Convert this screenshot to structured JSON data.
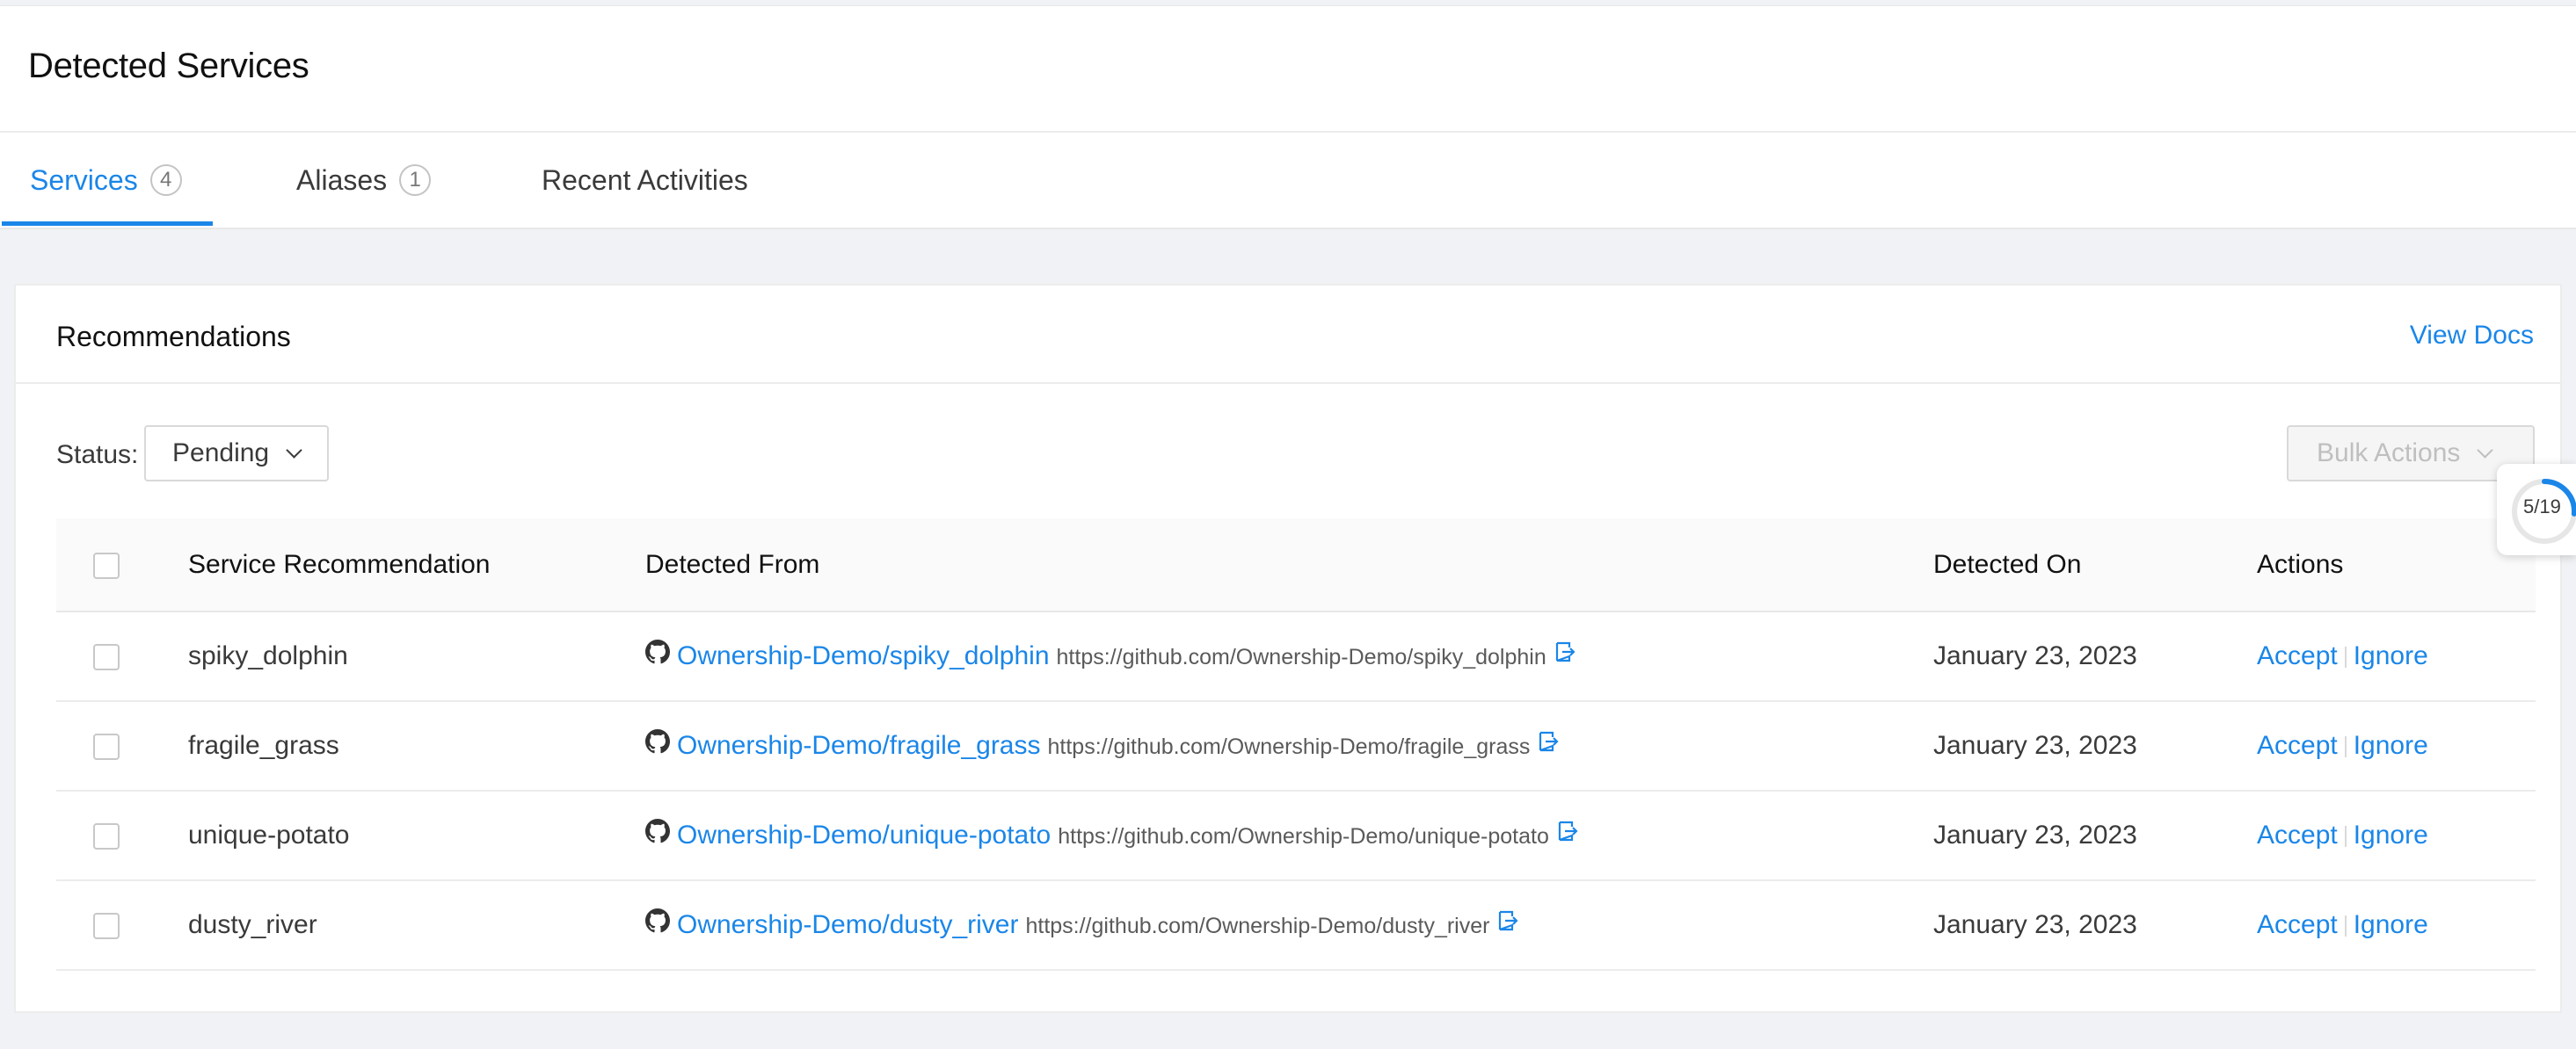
{
  "page": {
    "title": "Detected Services"
  },
  "tabs": [
    {
      "label": "Services",
      "count": "4",
      "active": true
    },
    {
      "label": "Aliases",
      "count": "1",
      "active": false
    },
    {
      "label": "Recent Activities",
      "active": false
    }
  ],
  "card": {
    "title": "Recommendations",
    "view_docs": "View Docs"
  },
  "filters": {
    "status_label": "Status:",
    "status_value": "Pending",
    "bulk_actions": "Bulk Actions"
  },
  "table": {
    "headers": {
      "service": "Service Recommendation",
      "detected_from": "Detected From",
      "detected_on": "Detected On",
      "actions": "Actions"
    },
    "rows": [
      {
        "service": "spiky_dolphin",
        "repo": "Ownership-Demo/spiky_dolphin",
        "url": "https://github.com/Ownership-Demo/spiky_dolphin",
        "detected_on": "January 23, 2023",
        "accept": "Accept",
        "ignore": "Ignore"
      },
      {
        "service": "fragile_grass",
        "repo": "Ownership-Demo/fragile_grass",
        "url": "https://github.com/Ownership-Demo/fragile_grass",
        "detected_on": "January 23, 2023",
        "accept": "Accept",
        "ignore": "Ignore"
      },
      {
        "service": "unique-potato",
        "repo": "Ownership-Demo/unique-potato",
        "url": "https://github.com/Ownership-Demo/unique-potato",
        "detected_on": "January 23, 2023",
        "accept": "Accept",
        "ignore": "Ignore"
      },
      {
        "service": "dusty_river",
        "repo": "Ownership-Demo/dusty_river",
        "url": "https://github.com/Ownership-Demo/dusty_river",
        "detected_on": "January 23, 2023",
        "accept": "Accept",
        "ignore": "Ignore"
      }
    ]
  },
  "progress_widget": {
    "label": "5/19",
    "fraction": 0.263
  },
  "colors": {
    "accent": "#1a86e8",
    "muted": "#bfbfbf",
    "background": "#f0f2f5"
  },
  "icons": {
    "repo_icon": "github-icon",
    "link_icon": "external-link-icon",
    "dropdown": "chevron-down-icon"
  }
}
